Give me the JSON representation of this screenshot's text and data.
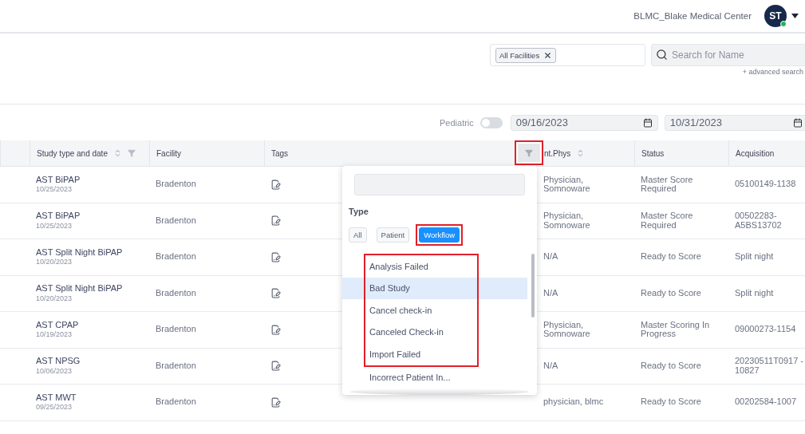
{
  "header": {
    "facility": "BLMC_Blake Medical Center",
    "avatar": {
      "initials": "ST",
      "online": true
    }
  },
  "filters": {
    "facility_tags": [
      "All Facilities"
    ],
    "search": {
      "placeholder": "Search for Name"
    },
    "advanced_link": "+ advanced search"
  },
  "toolbar": {
    "pediatric": {
      "label": "Pediatric",
      "on": false
    },
    "dates": [
      "09/16/2023",
      "10/31/2023"
    ]
  },
  "table": {
    "columns": [
      {
        "label": "Study type and date",
        "kind": "sort_filter"
      },
      {
        "label": "Facility",
        "kind": "plain"
      },
      {
        "label": "Tags",
        "kind": "plain"
      },
      {
        "label": "nt.Phys",
        "kind": "sort"
      },
      {
        "label": "Status",
        "kind": "plain"
      },
      {
        "label": "Acquisition",
        "kind": "plain"
      }
    ],
    "tags_filter_button": {
      "annotated": true
    },
    "rows": [
      {
        "study": "AST BiPAP",
        "date": "10/25/2023",
        "facility": "Bradenton",
        "phys": "Physician, Somnoware",
        "status": "Master Score Required",
        "acquisition": "05100149-1138"
      },
      {
        "study": "AST BiPAP",
        "date": "10/25/2023",
        "facility": "Bradenton",
        "phys": "Physician, Somnoware",
        "status": "Master Score Required",
        "acquisition": "00502283-A5BS13702"
      },
      {
        "study": "AST Split Night BiPAP",
        "date": "10/20/2023",
        "facility": "Bradenton",
        "phys": "N/A",
        "status": "Ready to Score",
        "acquisition": "Split night"
      },
      {
        "study": "AST Split Night BiPAP",
        "date": "10/20/2023",
        "facility": "Bradenton",
        "phys": "N/A",
        "status": "Ready to Score",
        "acquisition": "Split night"
      },
      {
        "study": "AST CPAP",
        "date": "10/19/2023",
        "facility": "Bradenton",
        "phys": "Physician, Somnoware",
        "status": "Master Scoring In Progress",
        "acquisition": "09000273-1154"
      },
      {
        "study": "AST NPSG",
        "date": "10/06/2023",
        "facility": "Bradenton",
        "phys": "N/A",
        "status": "Ready to Score",
        "acquisition": "20230511T0917 - 10827"
      },
      {
        "study": "AST MWT",
        "date": "09/25/2023",
        "facility": "Bradenton",
        "phys": "physician, blmc",
        "status": "Ready to Score",
        "acquisition": "00202584-1007"
      }
    ]
  },
  "tag_popup": {
    "type_label": "Type",
    "types": [
      {
        "label": "All",
        "selected": false,
        "annotated": false
      },
      {
        "label": "Patient",
        "selected": false,
        "annotated": false
      },
      {
        "label": "Workflow",
        "selected": true,
        "annotated": true
      }
    ],
    "items": [
      {
        "label": "Analysis Failed",
        "selected": false,
        "annotated": true
      },
      {
        "label": "Bad Study",
        "selected": true,
        "annotated": true
      },
      {
        "label": "Cancel check-in",
        "selected": false,
        "annotated": true
      },
      {
        "label": "Canceled Check-in",
        "selected": false,
        "annotated": true
      },
      {
        "label": "Import Failed",
        "selected": false,
        "annotated": true
      },
      {
        "label": "Incorrect Patient In...",
        "selected": false,
        "annotated": false
      }
    ]
  }
}
